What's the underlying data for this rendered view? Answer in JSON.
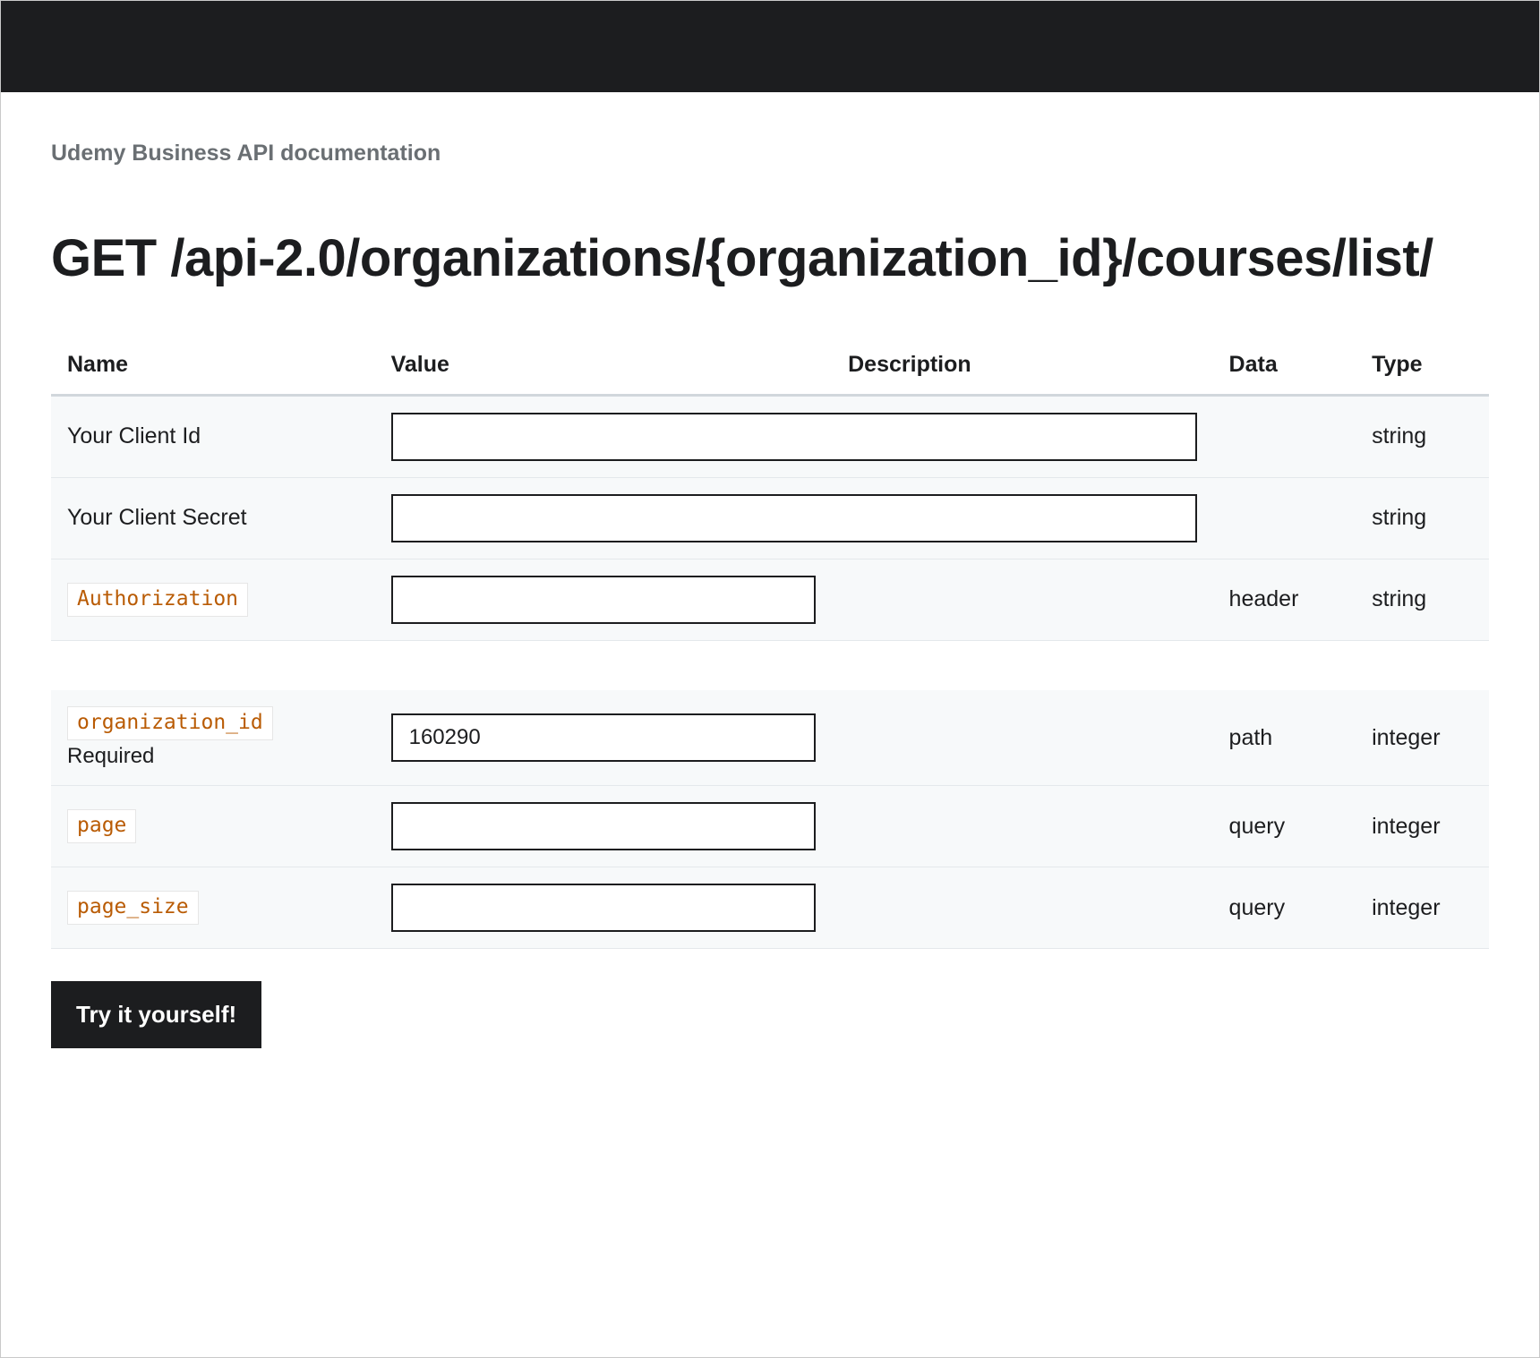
{
  "breadcrumb": "Udemy Business API documentation",
  "endpoint_title": "GET /api-2.0/organizations/{organization_id}/courses/list/",
  "table": {
    "headers": {
      "name": "Name",
      "value": "Value",
      "description": "Description",
      "data": "Data",
      "type": "Type"
    },
    "group1": [
      {
        "label": "Your Client Id",
        "code": false,
        "required": "",
        "value": "",
        "description": "",
        "data": "",
        "type": "string",
        "input_class": "wide-input"
      },
      {
        "label": "Your Client Secret",
        "code": false,
        "required": "",
        "value": "",
        "description": "",
        "data": "",
        "type": "string",
        "input_class": "wide-input"
      },
      {
        "label": "Authorization",
        "code": true,
        "required": "",
        "value": "",
        "description": "",
        "data": "header",
        "type": "string",
        "input_class": "auth-input"
      }
    ],
    "group2": [
      {
        "label": "organization_id",
        "code": true,
        "required": "Required",
        "value": "160290",
        "description": "",
        "data": "path",
        "type": "integer",
        "input_class": "narrow-input"
      },
      {
        "label": "page",
        "code": true,
        "required": "",
        "value": "",
        "description": "",
        "data": "query",
        "type": "integer",
        "input_class": "narrow-input"
      },
      {
        "label": "page_size",
        "code": true,
        "required": "",
        "value": "",
        "description": "",
        "data": "query",
        "type": "integer",
        "input_class": "narrow-input"
      }
    ]
  },
  "try_button": "Try it yourself!"
}
